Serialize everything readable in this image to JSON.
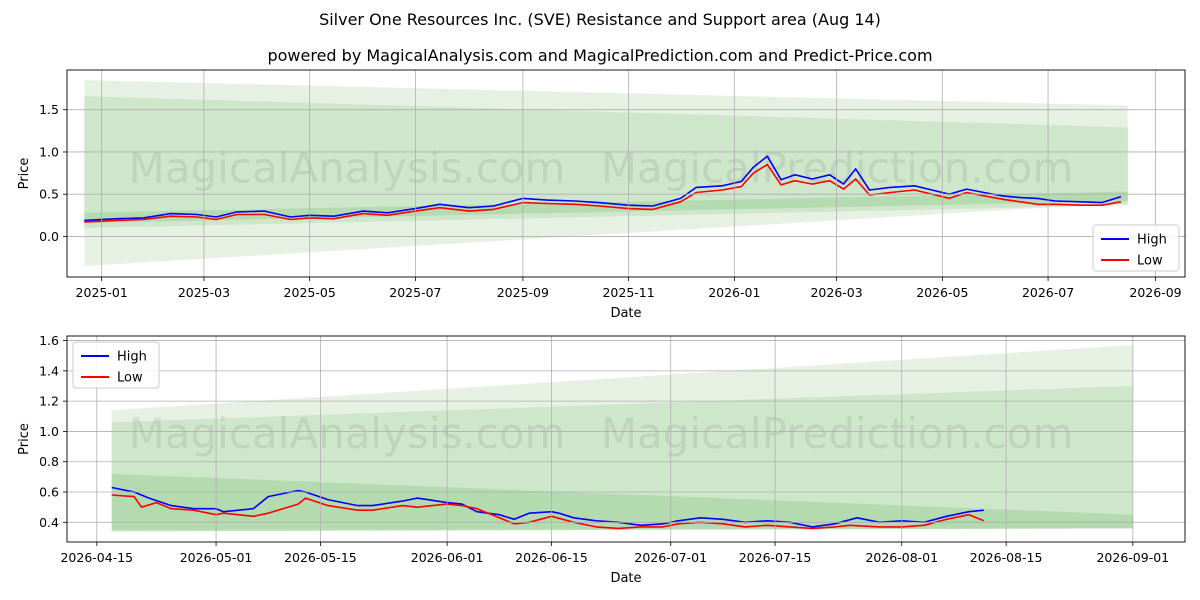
{
  "title": "Silver One Resources Inc. (SVE) Resistance and Support area (Aug 14)",
  "subtitle": "powered by MagicalAnalysis.com and MagicalPrediction.com and Predict-Price.com",
  "watermarks": [
    "MagicalAnalysis.com",
    "MagicalPrediction.com"
  ],
  "colors": {
    "high": "#0000ff",
    "low": "#ff0000",
    "band_light": "#e3efe0",
    "band_mid": "#c5e2c2",
    "band_dark": "#a9d4a4",
    "grid": "#b0b0b0"
  },
  "chart_data": [
    {
      "type": "line",
      "xlabel": "Date",
      "ylabel": "Price",
      "ylim": [
        -0.48,
        1.97
      ],
      "xlim": [
        "2024-12-12",
        "2026-09-18"
      ],
      "x_ticks": [
        "2025-01",
        "2025-03",
        "2025-05",
        "2025-07",
        "2025-09",
        "2025-11",
        "2026-01",
        "2026-03",
        "2026-05",
        "2026-07",
        "2026-09"
      ],
      "y_ticks": [
        "0.0",
        "0.5",
        "1.0",
        "1.5"
      ],
      "grid": true,
      "legend": {
        "position": "lower-right",
        "entries": [
          "High",
          "Low"
        ]
      },
      "bands": [
        {
          "x": [
            "2024-12-22",
            "2026-08-16"
          ],
          "upper": [
            1.85,
            1.55
          ],
          "lower": [
            -0.35,
            0.4
          ]
        },
        {
          "x": [
            "2024-12-22",
            "2026-08-16"
          ],
          "upper": [
            1.66,
            1.29
          ],
          "lower": [
            0.1,
            0.37
          ]
        },
        {
          "x": [
            "2024-12-22",
            "2026-08-16"
          ],
          "upper": [
            0.28,
            0.53
          ],
          "lower": [
            0.16,
            0.42
          ]
        }
      ],
      "series": [
        {
          "name": "High",
          "x": [
            "2024-12-22",
            "2025-01-10",
            "2025-01-25",
            "2025-02-10",
            "2025-02-25",
            "2025-03-08",
            "2025-03-20",
            "2025-04-05",
            "2025-04-20",
            "2025-05-01",
            "2025-05-15",
            "2025-06-01",
            "2025-06-15",
            "2025-07-01",
            "2025-07-15",
            "2025-08-01",
            "2025-08-15",
            "2025-09-01",
            "2025-09-15",
            "2025-10-01",
            "2025-10-15",
            "2025-11-01",
            "2025-11-15",
            "2025-12-01",
            "2025-12-10",
            "2025-12-25",
            "2026-01-05",
            "2026-01-12",
            "2026-01-20",
            "2026-01-28",
            "2026-02-05",
            "2026-02-15",
            "2026-02-25",
            "2026-03-05",
            "2026-03-12",
            "2026-03-20",
            "2026-04-01",
            "2026-04-15",
            "2026-04-25",
            "2026-05-05",
            "2026-05-15",
            "2026-05-25",
            "2026-06-05",
            "2026-06-15",
            "2026-06-25",
            "2026-07-05",
            "2026-07-20",
            "2026-08-01",
            "2026-08-12"
          ],
          "values": [
            0.19,
            0.21,
            0.22,
            0.27,
            0.26,
            0.23,
            0.29,
            0.3,
            0.23,
            0.25,
            0.24,
            0.3,
            0.28,
            0.33,
            0.38,
            0.34,
            0.36,
            0.45,
            0.43,
            0.42,
            0.4,
            0.37,
            0.36,
            0.45,
            0.58,
            0.6,
            0.65,
            0.82,
            0.95,
            0.67,
            0.73,
            0.68,
            0.73,
            0.62,
            0.8,
            0.55,
            0.58,
            0.6,
            0.55,
            0.5,
            0.56,
            0.52,
            0.48,
            0.46,
            0.45,
            0.42,
            0.41,
            0.4,
            0.47
          ]
        },
        {
          "name": "Low",
          "x": [
            "2024-12-22",
            "2025-01-10",
            "2025-01-25",
            "2025-02-10",
            "2025-02-25",
            "2025-03-08",
            "2025-03-20",
            "2025-04-05",
            "2025-04-20",
            "2025-05-01",
            "2025-05-15",
            "2025-06-01",
            "2025-06-15",
            "2025-07-01",
            "2025-07-15",
            "2025-08-01",
            "2025-08-15",
            "2025-09-01",
            "2025-09-15",
            "2025-10-01",
            "2025-10-15",
            "2025-11-01",
            "2025-11-15",
            "2025-12-01",
            "2025-12-10",
            "2025-12-25",
            "2026-01-05",
            "2026-01-12",
            "2026-01-20",
            "2026-01-28",
            "2026-02-05",
            "2026-02-15",
            "2026-02-25",
            "2026-03-05",
            "2026-03-12",
            "2026-03-20",
            "2026-04-01",
            "2026-04-15",
            "2026-04-25",
            "2026-05-05",
            "2026-05-15",
            "2026-05-25",
            "2026-06-05",
            "2026-06-15",
            "2026-06-25",
            "2026-07-05",
            "2026-07-20",
            "2026-08-01",
            "2026-08-12"
          ],
          "values": [
            0.17,
            0.19,
            0.2,
            0.24,
            0.23,
            0.2,
            0.26,
            0.26,
            0.2,
            0.22,
            0.21,
            0.27,
            0.25,
            0.3,
            0.34,
            0.3,
            0.32,
            0.4,
            0.39,
            0.38,
            0.36,
            0.33,
            0.32,
            0.41,
            0.52,
            0.55,
            0.59,
            0.75,
            0.85,
            0.61,
            0.66,
            0.62,
            0.66,
            0.56,
            0.68,
            0.49,
            0.52,
            0.55,
            0.5,
            0.45,
            0.52,
            0.48,
            0.44,
            0.41,
            0.38,
            0.38,
            0.37,
            0.37,
            0.41
          ]
        }
      ]
    },
    {
      "type": "line",
      "xlabel": "Date",
      "ylabel": "Price",
      "ylim": [
        0.27,
        1.63
      ],
      "xlim": [
        "2026-04-11",
        "2026-09-08"
      ],
      "x_ticks": [
        "2026-04-15",
        "2026-05-01",
        "2026-05-15",
        "2026-06-01",
        "2026-06-15",
        "2026-07-01",
        "2026-07-15",
        "2026-08-01",
        "2026-08-15",
        "2026-09-01"
      ],
      "y_ticks": [
        "0.4",
        "0.6",
        "0.8",
        "1.0",
        "1.2",
        "1.4",
        "1.6"
      ],
      "grid": true,
      "legend": {
        "position": "upper-left",
        "entries": [
          "High",
          "Low"
        ]
      },
      "bands": [
        {
          "x": [
            "2026-04-17",
            "2026-09-01"
          ],
          "upper": [
            1.14,
            1.57
          ],
          "lower": [
            0.36,
            0.37
          ]
        },
        {
          "x": [
            "2026-04-17",
            "2026-09-01"
          ],
          "upper": [
            1.06,
            1.3
          ],
          "lower": [
            0.35,
            0.36
          ]
        },
        {
          "x": [
            "2026-04-17",
            "2026-09-01"
          ],
          "upper": [
            0.72,
            0.45
          ],
          "lower": [
            0.34,
            0.36
          ]
        }
      ],
      "series": [
        {
          "name": "High",
          "x": [
            "2026-04-17",
            "2026-04-20",
            "2026-04-22",
            "2026-04-25",
            "2026-04-28",
            "2026-05-01",
            "2026-05-02",
            "2026-05-06",
            "2026-05-08",
            "2026-05-12",
            "2026-05-13",
            "2026-05-16",
            "2026-05-20",
            "2026-05-22",
            "2026-05-26",
            "2026-05-28",
            "2026-06-01",
            "2026-06-03",
            "2026-06-05",
            "2026-06-08",
            "2026-06-10",
            "2026-06-12",
            "2026-06-15",
            "2026-06-16",
            "2026-06-18",
            "2026-06-21",
            "2026-06-24",
            "2026-06-27",
            "2026-06-30",
            "2026-07-02",
            "2026-07-05",
            "2026-07-08",
            "2026-07-11",
            "2026-07-14",
            "2026-07-17",
            "2026-07-20",
            "2026-07-23",
            "2026-07-26",
            "2026-07-29",
            "2026-08-01",
            "2026-08-04",
            "2026-08-07",
            "2026-08-10",
            "2026-08-12"
          ],
          "values": [
            0.63,
            0.6,
            0.56,
            0.51,
            0.49,
            0.49,
            0.47,
            0.49,
            0.57,
            0.61,
            0.6,
            0.55,
            0.51,
            0.51,
            0.54,
            0.56,
            0.53,
            0.52,
            0.47,
            0.45,
            0.42,
            0.46,
            0.47,
            0.46,
            0.43,
            0.41,
            0.4,
            0.38,
            0.39,
            0.41,
            0.43,
            0.42,
            0.4,
            0.41,
            0.4,
            0.37,
            0.39,
            0.43,
            0.4,
            0.41,
            0.4,
            0.44,
            0.47,
            0.48
          ]
        },
        {
          "name": "Low",
          "x": [
            "2026-04-17",
            "2026-04-20",
            "2026-04-21",
            "2026-04-23",
            "2026-04-25",
            "2026-04-28",
            "2026-05-01",
            "2026-05-02",
            "2026-05-06",
            "2026-05-08",
            "2026-05-12",
            "2026-05-13",
            "2026-05-16",
            "2026-05-20",
            "2026-05-22",
            "2026-05-26",
            "2026-05-28",
            "2026-06-01",
            "2026-06-03",
            "2026-06-05",
            "2026-06-08",
            "2026-06-10",
            "2026-06-12",
            "2026-06-15",
            "2026-06-18",
            "2026-06-21",
            "2026-06-24",
            "2026-06-27",
            "2026-06-30",
            "2026-07-02",
            "2026-07-05",
            "2026-07-08",
            "2026-07-11",
            "2026-07-14",
            "2026-07-17",
            "2026-07-20",
            "2026-07-23",
            "2026-07-25",
            "2026-07-29",
            "2026-08-01",
            "2026-08-04",
            "2026-08-07",
            "2026-08-10",
            "2026-08-12"
          ],
          "values": [
            0.58,
            0.57,
            0.5,
            0.53,
            0.49,
            0.48,
            0.45,
            0.46,
            0.44,
            0.46,
            0.52,
            0.56,
            0.51,
            0.48,
            0.48,
            0.51,
            0.5,
            0.52,
            0.51,
            0.49,
            0.43,
            0.39,
            0.4,
            0.44,
            0.4,
            0.37,
            0.36,
            0.37,
            0.37,
            0.39,
            0.4,
            0.39,
            0.37,
            0.38,
            0.37,
            0.36,
            0.37,
            0.38,
            0.37,
            0.37,
            0.38,
            0.42,
            0.45,
            0.41
          ]
        }
      ]
    }
  ]
}
